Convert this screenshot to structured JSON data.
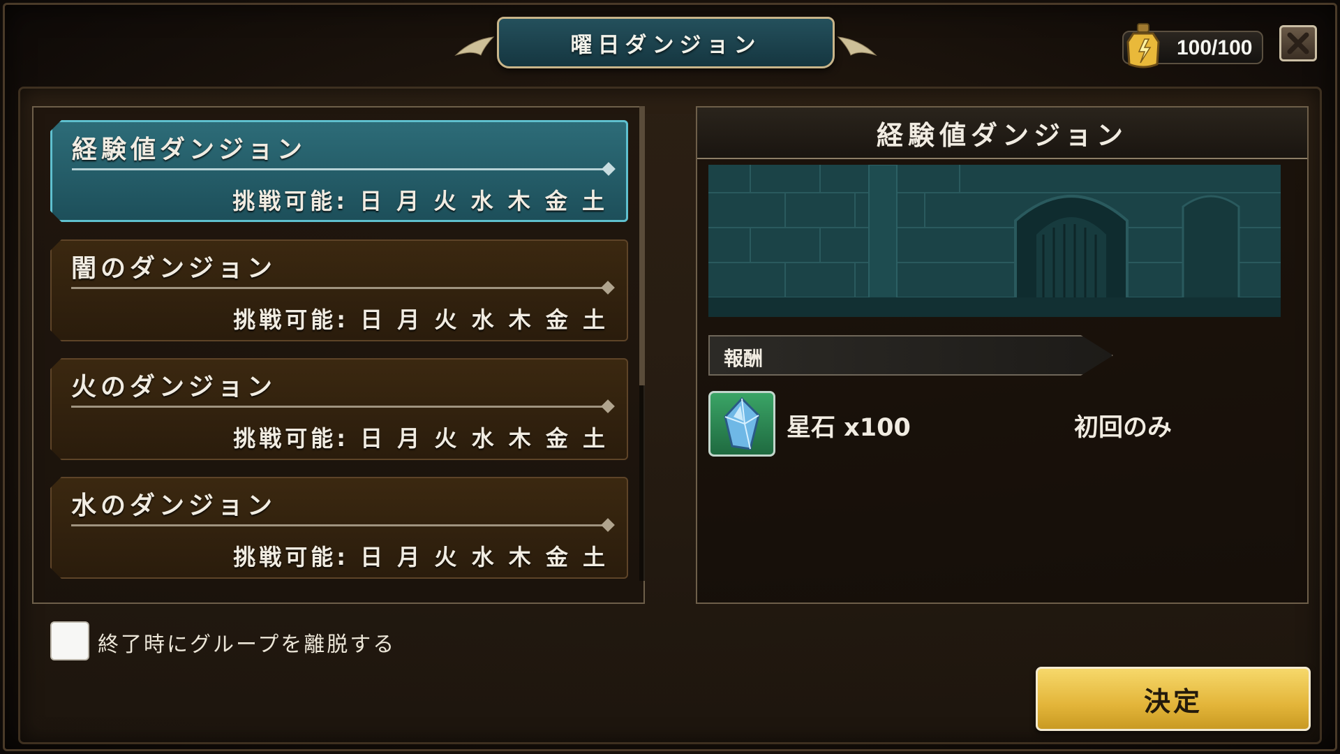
{
  "header": {
    "title": "曜日ダンジョン",
    "stamina": "100/100",
    "close_icon": "close-icon"
  },
  "dungeons": [
    {
      "name": "経験値ダンジョン",
      "availability": "挑戦可能: 日 月 火 水 木 金 土",
      "selected": true
    },
    {
      "name": "闇のダンジョン",
      "availability": "挑戦可能: 日 月 火 水 木 金 土",
      "selected": false
    },
    {
      "name": "火のダンジョン",
      "availability": "挑戦可能: 日 月 火 水 木 金 土",
      "selected": false
    },
    {
      "name": "水のダンジョン",
      "availability": "挑戦可能: 日 月 火 水 木 金 土",
      "selected": false
    }
  ],
  "detail": {
    "title": "経験値ダンジョン",
    "reward_header": "報酬",
    "rewards": [
      {
        "name": "星石 x100",
        "condition": "初回のみ",
        "icon": "star-stone-icon"
      }
    ]
  },
  "options": {
    "leave_group_label": "終了時にグループを離脱する",
    "leave_group_checked": false
  },
  "actions": {
    "confirm_label": "決定"
  },
  "colors": {
    "selected_item": "#2d6c78",
    "item_bg": "#3b2810",
    "confirm_button": "#e3b53a",
    "reward_frame": "#3aa466"
  }
}
